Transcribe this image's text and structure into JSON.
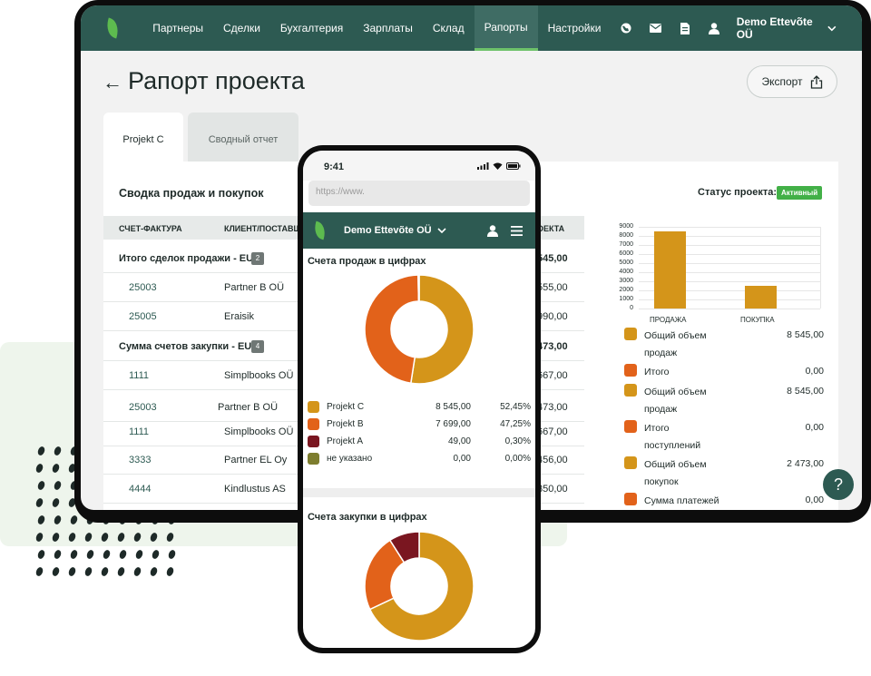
{
  "desktop": {
    "nav": {
      "items": [
        "Партнеры",
        "Сделки",
        "Бухгалтерия",
        "Зарплаты",
        "Склад",
        "Рапорты",
        "Настройки"
      ],
      "active": "Рапорты",
      "company": "Demo Ettevõte OÜ"
    },
    "page_title": "Рапорт проекта",
    "back_icon": "←",
    "export_label": "Экспорт",
    "tabs": [
      "Projekt C",
      "Сводный отчет"
    ],
    "card_title": "Сводка продаж и покупок",
    "status_label": "Статус проекта:",
    "status_value": "Активный",
    "table": {
      "headers": [
        "СЧЕТ-ФАКТУРА",
        "КЛИЕНТ/ПОСТАВЩ",
        "ОЕКТА"
      ],
      "rows": [
        {
          "type": "group",
          "label": "Итого сделок продажи - EUR",
          "count": "2",
          "amount": "545,00"
        },
        {
          "type": "item",
          "invoice": "25003",
          "client": "Partner B OÜ",
          "amount": "555,00"
        },
        {
          "type": "item",
          "invoice": "25005",
          "client": "Eraisik",
          "amount": "990,00"
        },
        {
          "type": "group",
          "label": "Сумма счетов закупки - EUR",
          "count": "4",
          "amount": "473,00"
        },
        {
          "type": "item",
          "invoice": "1111",
          "client": "Simplbooks OÜ",
          "amount": "667,00"
        },
        {
          "type": "item",
          "invoice": "25003",
          "client": "Partner B OÜ",
          "amount": "473,00"
        },
        {
          "type": "item",
          "invoice": "1111",
          "client": "Simplbooks OÜ",
          "amount": "667,00"
        },
        {
          "type": "item",
          "invoice": "3333",
          "client": "Partner EL Oy",
          "amount": "456,00"
        },
        {
          "type": "item",
          "invoice": "4444",
          "client": "Kindlustus AS",
          "amount": "350,00"
        }
      ]
    },
    "legend": [
      {
        "label": "Общий объем продаж",
        "value": "8 545,00",
        "color": "#d4951a"
      },
      {
        "label": "Итого",
        "value": "0,00",
        "color": "#e2621a"
      },
      {
        "label": "Общий объем продаж",
        "value": "8 545,00",
        "color": "#d4951a"
      },
      {
        "label": "Итого поступлений",
        "value": "0,00",
        "color": "#e2621a"
      },
      {
        "label": "Общий объем покупок",
        "value": "2 473,00",
        "color": "#d4951a"
      },
      {
        "label": "Сумма платежей",
        "value": "0,00",
        "color": "#e2621a"
      }
    ],
    "help_label": "?"
  },
  "chart_data": [
    {
      "type": "bar",
      "categories": [
        "ПРОДАЖА",
        "ПОКУПКА"
      ],
      "values": [
        8545,
        2473
      ],
      "ylim": [
        0,
        9000
      ],
      "yticks": [
        "0",
        "1000",
        "2000",
        "3000",
        "4000",
        "5000",
        "6000",
        "7000",
        "8000",
        "9000"
      ],
      "grid": true,
      "color": "#d4951a"
    },
    {
      "type": "pie",
      "title": "Счета продаж в цифрах",
      "labels": [
        "Projekt C",
        "Projekt B",
        "Projekt A",
        "не указано"
      ],
      "values": [
        8545.0,
        7699.0,
        49.0,
        0.0
      ],
      "value_labels": [
        "8 545,00",
        "7 699,00",
        "49,00",
        "0,00"
      ],
      "percent_labels": [
        "52,45%",
        "47,25%",
        "0,30%",
        "0,00%"
      ],
      "colors": [
        "#d4951a",
        "#e2621a",
        "#7a1620",
        "#7d7d2e"
      ]
    },
    {
      "type": "pie",
      "title": "Счета закупки в цифрах",
      "values": [
        0.68,
        0.23,
        0.09
      ],
      "colors": [
        "#d4951a",
        "#e2621a",
        "#7a1620"
      ]
    }
  ],
  "phone": {
    "time": "9:41",
    "url_placeholder": "https://www.",
    "company": "Demo Ettevõte OÜ"
  }
}
